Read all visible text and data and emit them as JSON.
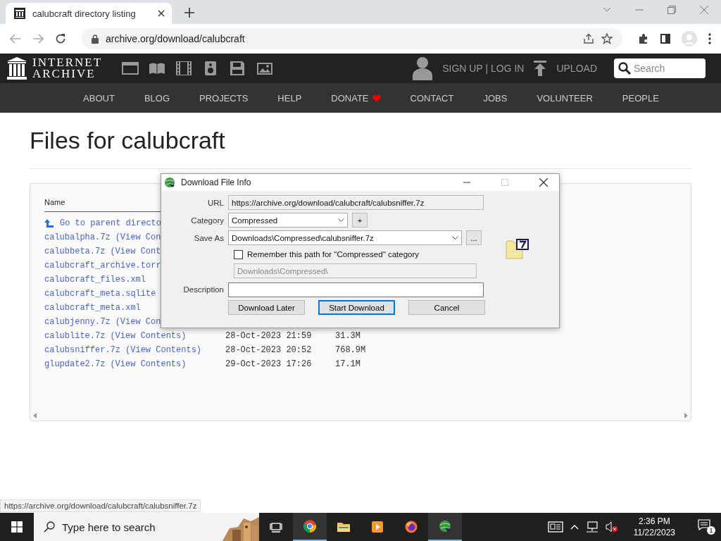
{
  "browser": {
    "tab": {
      "title": "calubcraft directory listing",
      "selected": true
    },
    "address": "archive.org/download/calubcraft"
  },
  "site_header": {
    "logo_lines": [
      "INTERNET",
      "ARCHIVE"
    ],
    "account": "SIGN UP | LOG IN",
    "upload": "UPLOAD",
    "search": {
      "placeholder": "Search"
    }
  },
  "nav": [
    {
      "label": "ABOUT"
    },
    {
      "label": "BLOG"
    },
    {
      "label": "PROJECTS"
    },
    {
      "label": "HELP"
    },
    {
      "label": "DONATE",
      "heart": true
    },
    {
      "label": "CONTACT"
    },
    {
      "label": "JOBS"
    },
    {
      "label": "VOLUNTEER"
    },
    {
      "label": "PEOPLE"
    }
  ],
  "page_title": "Files for calubcraft",
  "listing": {
    "columns": [
      "Name"
    ],
    "rows": [
      {
        "kind": "parent",
        "name": "Go to parent directo"
      },
      {
        "kind": "file",
        "name": "calubalpha.7z",
        "link": "(View Con"
      },
      {
        "kind": "file",
        "name": "calubbeta.7z",
        "link": "(View Cont"
      },
      {
        "kind": "file",
        "name": "calubcraft_archive.torr"
      },
      {
        "kind": "file",
        "name": "calubcraft_files.xml"
      },
      {
        "kind": "file",
        "name": "calubcraft_meta.sqlite"
      },
      {
        "kind": "file",
        "name": "calubcraft_meta.xml"
      },
      {
        "kind": "file",
        "name": "calubjenny.7z",
        "link": "(View Con"
      },
      {
        "kind": "file",
        "name": "calublite.7z",
        "link": "(View Contents)",
        "date": "28-Oct-2023 21:59",
        "size": "31.3M"
      },
      {
        "kind": "file",
        "name": "calubsniffer.7z",
        "link": "(View Contents)",
        "date": "28-Oct-2023 20:52",
        "size": "768.9M"
      },
      {
        "kind": "file",
        "name": "glupdate2.7z",
        "link": "(View Contents)",
        "date": "29-Oct-2023 17:26",
        "size": "17.1M"
      }
    ]
  },
  "status_url": "https://archive.org/download/calubcraft/calubsniffer.7z",
  "dialog": {
    "title": "Download File Info",
    "url_label": "URL",
    "url": "https://archive.org/download/calubcraft/calubsniffer.7z",
    "category_label": "Category",
    "category": "Compressed",
    "add": "+",
    "save_label": "Save As",
    "save_as": "Downloads\\Compressed\\calubsniffer.7z",
    "browse": "...",
    "remember": {
      "label": "Remember this path for \"Compressed\" category",
      "checked": false
    },
    "path": "Downloads\\Compressed\\",
    "description_label": "Description",
    "buttons": [
      {
        "label": "Download Later",
        "selected": false
      },
      {
        "label": "Start Download",
        "selected": true
      },
      {
        "label": "Cancel",
        "selected": false
      }
    ]
  },
  "taskbar": {
    "search_placeholder": "Type here to search",
    "apps": [
      {
        "kind": "taskview",
        "active": false
      },
      {
        "kind": "chrome",
        "active": true
      },
      {
        "kind": "folder",
        "active": false
      },
      {
        "kind": "media",
        "active": false
      },
      {
        "kind": "firefox",
        "active": false
      },
      {
        "kind": "globe",
        "active": true
      }
    ],
    "time": "2:36 PM",
    "date": "11/22/2023",
    "notifications": "1"
  }
}
